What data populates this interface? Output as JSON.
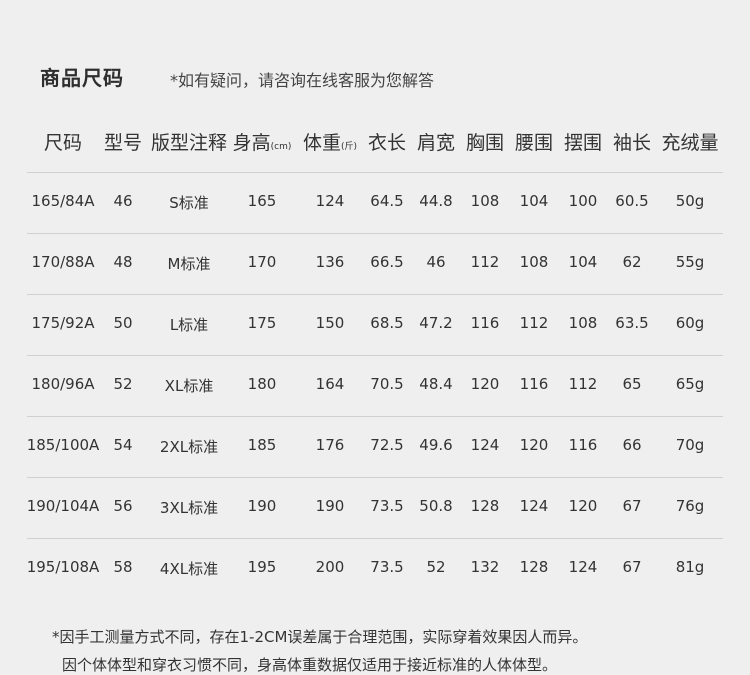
{
  "title": "商品尺码",
  "note": "*如有疑问，请咨询在线客服为您解答",
  "headers": [
    {
      "label": "尺码",
      "unit": ""
    },
    {
      "label": "型号",
      "unit": ""
    },
    {
      "label": "版型注释",
      "unit": ""
    },
    {
      "label": "身高",
      "unit": "(cm)"
    },
    {
      "label": "体重",
      "unit": "(斤)"
    },
    {
      "label": "衣长",
      "unit": ""
    },
    {
      "label": "肩宽",
      "unit": ""
    },
    {
      "label": "胸围",
      "unit": ""
    },
    {
      "label": "腰围",
      "unit": ""
    },
    {
      "label": "摆围",
      "unit": ""
    },
    {
      "label": "袖长",
      "unit": ""
    },
    {
      "label": "充绒量",
      "unit": ""
    }
  ],
  "rows": [
    [
      "165/84A",
      "46",
      "S标准",
      "165",
      "124",
      "64.5",
      "44.8",
      "108",
      "104",
      "100",
      "60.5",
      "50g"
    ],
    [
      "170/88A",
      "48",
      "M标准",
      "170",
      "136",
      "66.5",
      "46",
      "112",
      "108",
      "104",
      "62",
      "55g"
    ],
    [
      "175/92A",
      "50",
      "L标准",
      "175",
      "150",
      "68.5",
      "47.2",
      "116",
      "112",
      "108",
      "63.5",
      "60g"
    ],
    [
      "180/96A",
      "52",
      "XL标准",
      "180",
      "164",
      "70.5",
      "48.4",
      "120",
      "116",
      "112",
      "65",
      "65g"
    ],
    [
      "185/100A",
      "54",
      "2XL标准",
      "185",
      "176",
      "72.5",
      "49.6",
      "124",
      "120",
      "116",
      "66",
      "70g"
    ],
    [
      "190/104A",
      "56",
      "3XL标准",
      "190",
      "190",
      "73.5",
      "50.8",
      "128",
      "124",
      "120",
      "67",
      "76g"
    ],
    [
      "195/108A",
      "58",
      "4XL标准",
      "195",
      "200",
      "73.5",
      "52",
      "132",
      "128",
      "124",
      "67",
      "81g"
    ]
  ],
  "footnotes": [
    "*因手工测量方式不同，存在1-2CM误差属于合理范围，实际穿着效果因人而异。",
    "因个体体型和穿衣习惯不同，身高体重数据仅适用于接近标准的人体体型。"
  ]
}
